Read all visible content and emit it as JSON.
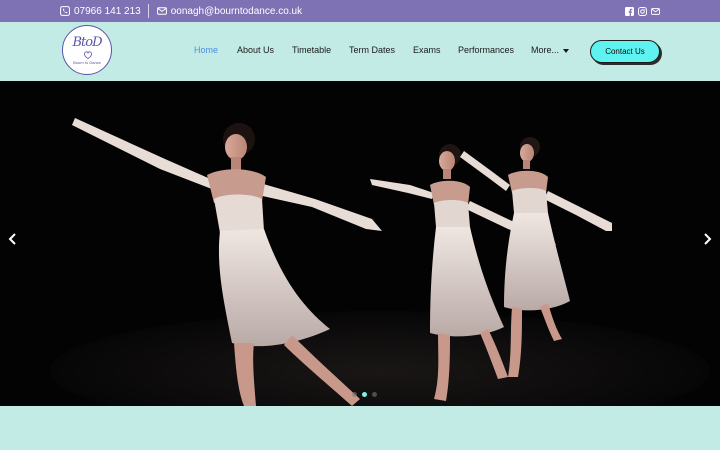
{
  "topbar": {
    "phone": "07966 141 213",
    "email": "oonagh@bourntodance.co.uk",
    "social": [
      "facebook-icon",
      "instagram-icon",
      "envelope-icon"
    ]
  },
  "logo": {
    "monogram": "BtoD",
    "tagline": "Bourn to Dance"
  },
  "nav": {
    "items": [
      "Home",
      "About Us",
      "Timetable",
      "Term Dates",
      "Exams",
      "Performances",
      "More..."
    ],
    "active": "Home"
  },
  "cta": {
    "label": "Contact Us"
  },
  "slider": {
    "slide_count": 3,
    "current_slide": 2
  },
  "colors": {
    "topbar": "#7e72b4",
    "header_bg": "#c2ebe6",
    "accent": "#5ef2f0",
    "nav_active": "#4e8fe0"
  }
}
